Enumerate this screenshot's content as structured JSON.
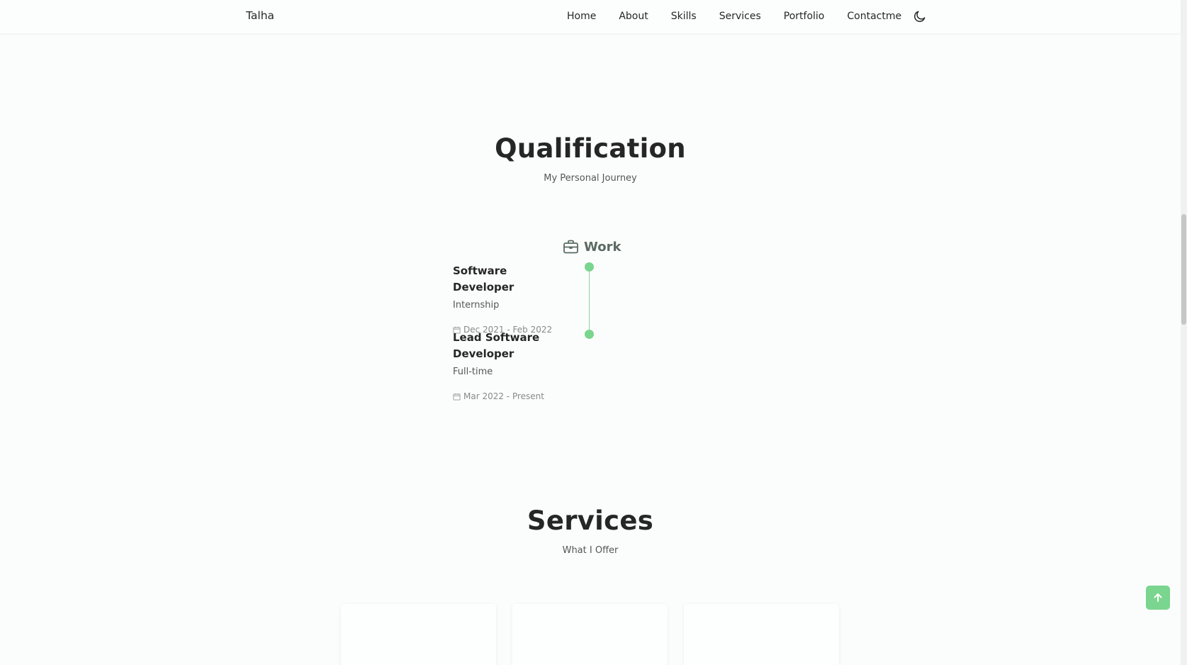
{
  "header": {
    "logo": "Talha",
    "nav": [
      "Home",
      "About",
      "Skills",
      "Services",
      "Portfolio",
      "Contactme"
    ],
    "theme_toggle_icon": "moon-icon"
  },
  "qualification": {
    "title": "Qualification",
    "subtitle": "My Personal Journey",
    "tab": {
      "label": "Work",
      "icon": "briefcase-icon"
    },
    "items": [
      {
        "role": "Software Developer",
        "type": "Internship",
        "date": "Dec 2021 - Feb 2022"
      },
      {
        "role": "Lead Software Developer",
        "type": "Full-time",
        "date": "Mar 2022 - Present"
      }
    ]
  },
  "services": {
    "title": "Services",
    "subtitle": "What I Offer"
  },
  "scroll_up_icon": "arrow-up-icon",
  "colors": {
    "accent": "#7ad58e",
    "background": "#fbfdfc",
    "text": "#262626"
  }
}
